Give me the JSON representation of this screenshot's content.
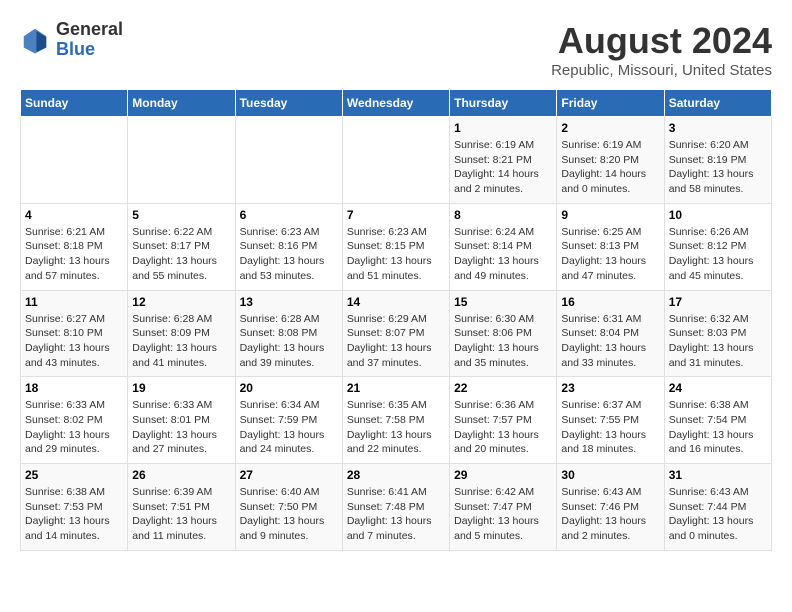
{
  "header": {
    "logo_general": "General",
    "logo_blue": "Blue",
    "title": "August 2024",
    "subtitle": "Republic, Missouri, United States"
  },
  "weekdays": [
    "Sunday",
    "Monday",
    "Tuesday",
    "Wednesday",
    "Thursday",
    "Friday",
    "Saturday"
  ],
  "weeks": [
    [
      {
        "day": "",
        "info": ""
      },
      {
        "day": "",
        "info": ""
      },
      {
        "day": "",
        "info": ""
      },
      {
        "day": "",
        "info": ""
      },
      {
        "day": "1",
        "info": "Sunrise: 6:19 AM\nSunset: 8:21 PM\nDaylight: 14 hours\nand 2 minutes."
      },
      {
        "day": "2",
        "info": "Sunrise: 6:19 AM\nSunset: 8:20 PM\nDaylight: 14 hours\nand 0 minutes."
      },
      {
        "day": "3",
        "info": "Sunrise: 6:20 AM\nSunset: 8:19 PM\nDaylight: 13 hours\nand 58 minutes."
      }
    ],
    [
      {
        "day": "4",
        "info": "Sunrise: 6:21 AM\nSunset: 8:18 PM\nDaylight: 13 hours\nand 57 minutes."
      },
      {
        "day": "5",
        "info": "Sunrise: 6:22 AM\nSunset: 8:17 PM\nDaylight: 13 hours\nand 55 minutes."
      },
      {
        "day": "6",
        "info": "Sunrise: 6:23 AM\nSunset: 8:16 PM\nDaylight: 13 hours\nand 53 minutes."
      },
      {
        "day": "7",
        "info": "Sunrise: 6:23 AM\nSunset: 8:15 PM\nDaylight: 13 hours\nand 51 minutes."
      },
      {
        "day": "8",
        "info": "Sunrise: 6:24 AM\nSunset: 8:14 PM\nDaylight: 13 hours\nand 49 minutes."
      },
      {
        "day": "9",
        "info": "Sunrise: 6:25 AM\nSunset: 8:13 PM\nDaylight: 13 hours\nand 47 minutes."
      },
      {
        "day": "10",
        "info": "Sunrise: 6:26 AM\nSunset: 8:12 PM\nDaylight: 13 hours\nand 45 minutes."
      }
    ],
    [
      {
        "day": "11",
        "info": "Sunrise: 6:27 AM\nSunset: 8:10 PM\nDaylight: 13 hours\nand 43 minutes."
      },
      {
        "day": "12",
        "info": "Sunrise: 6:28 AM\nSunset: 8:09 PM\nDaylight: 13 hours\nand 41 minutes."
      },
      {
        "day": "13",
        "info": "Sunrise: 6:28 AM\nSunset: 8:08 PM\nDaylight: 13 hours\nand 39 minutes."
      },
      {
        "day": "14",
        "info": "Sunrise: 6:29 AM\nSunset: 8:07 PM\nDaylight: 13 hours\nand 37 minutes."
      },
      {
        "day": "15",
        "info": "Sunrise: 6:30 AM\nSunset: 8:06 PM\nDaylight: 13 hours\nand 35 minutes."
      },
      {
        "day": "16",
        "info": "Sunrise: 6:31 AM\nSunset: 8:04 PM\nDaylight: 13 hours\nand 33 minutes."
      },
      {
        "day": "17",
        "info": "Sunrise: 6:32 AM\nSunset: 8:03 PM\nDaylight: 13 hours\nand 31 minutes."
      }
    ],
    [
      {
        "day": "18",
        "info": "Sunrise: 6:33 AM\nSunset: 8:02 PM\nDaylight: 13 hours\nand 29 minutes."
      },
      {
        "day": "19",
        "info": "Sunrise: 6:33 AM\nSunset: 8:01 PM\nDaylight: 13 hours\nand 27 minutes."
      },
      {
        "day": "20",
        "info": "Sunrise: 6:34 AM\nSunset: 7:59 PM\nDaylight: 13 hours\nand 24 minutes."
      },
      {
        "day": "21",
        "info": "Sunrise: 6:35 AM\nSunset: 7:58 PM\nDaylight: 13 hours\nand 22 minutes."
      },
      {
        "day": "22",
        "info": "Sunrise: 6:36 AM\nSunset: 7:57 PM\nDaylight: 13 hours\nand 20 minutes."
      },
      {
        "day": "23",
        "info": "Sunrise: 6:37 AM\nSunset: 7:55 PM\nDaylight: 13 hours\nand 18 minutes."
      },
      {
        "day": "24",
        "info": "Sunrise: 6:38 AM\nSunset: 7:54 PM\nDaylight: 13 hours\nand 16 minutes."
      }
    ],
    [
      {
        "day": "25",
        "info": "Sunrise: 6:38 AM\nSunset: 7:53 PM\nDaylight: 13 hours\nand 14 minutes."
      },
      {
        "day": "26",
        "info": "Sunrise: 6:39 AM\nSunset: 7:51 PM\nDaylight: 13 hours\nand 11 minutes."
      },
      {
        "day": "27",
        "info": "Sunrise: 6:40 AM\nSunset: 7:50 PM\nDaylight: 13 hours\nand 9 minutes."
      },
      {
        "day": "28",
        "info": "Sunrise: 6:41 AM\nSunset: 7:48 PM\nDaylight: 13 hours\nand 7 minutes."
      },
      {
        "day": "29",
        "info": "Sunrise: 6:42 AM\nSunset: 7:47 PM\nDaylight: 13 hours\nand 5 minutes."
      },
      {
        "day": "30",
        "info": "Sunrise: 6:43 AM\nSunset: 7:46 PM\nDaylight: 13 hours\nand 2 minutes."
      },
      {
        "day": "31",
        "info": "Sunrise: 6:43 AM\nSunset: 7:44 PM\nDaylight: 13 hours\nand 0 minutes."
      }
    ]
  ]
}
